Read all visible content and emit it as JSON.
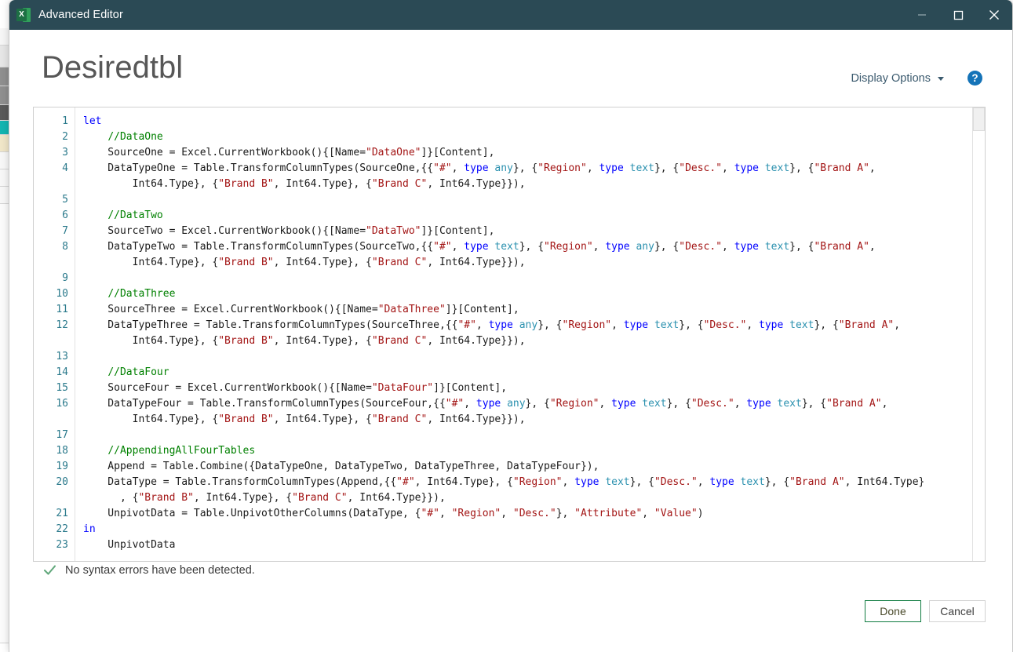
{
  "window": {
    "title": "Advanced Editor",
    "app_icon": "excel-icon",
    "icon_letter": "X",
    "minimize_label": "Minimize",
    "maximize_label": "Maximize",
    "close_label": "Close"
  },
  "header": {
    "page_title": "Desiredtbl",
    "display_options_label": "Display Options",
    "help_label": "?"
  },
  "editor": {
    "line_numbers": [
      "1",
      "2",
      "3",
      "4",
      "",
      "5",
      "6",
      "7",
      "8",
      "",
      "9",
      "10",
      "11",
      "12",
      "",
      "13",
      "14",
      "15",
      "16",
      "",
      "17",
      "18",
      "19",
      "20",
      "",
      "21",
      "22",
      "23"
    ],
    "lines": [
      {
        "n": "1",
        "tokens": [
          {
            "t": "let",
            "c": "k"
          }
        ]
      },
      {
        "n": "2",
        "tokens": [
          {
            "t": "    ",
            "c": "pl"
          },
          {
            "t": "//DataOne",
            "c": "cm"
          }
        ]
      },
      {
        "n": "3",
        "tokens": [
          {
            "t": "    SourceOne = Excel.CurrentWorkbook(){[Name=",
            "c": "pl"
          },
          {
            "t": "\"DataOne\"",
            "c": "st"
          },
          {
            "t": "]}[Content],",
            "c": "pl"
          }
        ]
      },
      {
        "n": "4",
        "tokens": [
          {
            "t": "    DataTypeOne = Table.TransformColumnTypes(SourceOne,{{",
            "c": "pl"
          },
          {
            "t": "\"#\"",
            "c": "st"
          },
          {
            "t": ", ",
            "c": "pl"
          },
          {
            "t": "type",
            "c": "k"
          },
          {
            "t": " ",
            "c": "pl"
          },
          {
            "t": "any",
            "c": "ty"
          },
          {
            "t": "}, {",
            "c": "pl"
          },
          {
            "t": "\"Region\"",
            "c": "st"
          },
          {
            "t": ", ",
            "c": "pl"
          },
          {
            "t": "type",
            "c": "k"
          },
          {
            "t": " ",
            "c": "pl"
          },
          {
            "t": "text",
            "c": "ty"
          },
          {
            "t": "}, {",
            "c": "pl"
          },
          {
            "t": "\"Desc.\"",
            "c": "st"
          },
          {
            "t": ", ",
            "c": "pl"
          },
          {
            "t": "type",
            "c": "k"
          },
          {
            "t": " ",
            "c": "pl"
          },
          {
            "t": "text",
            "c": "ty"
          },
          {
            "t": "}, {",
            "c": "pl"
          },
          {
            "t": "\"Brand A\"",
            "c": "st"
          },
          {
            "t": ",",
            "c": "pl"
          }
        ]
      },
      {
        "n": "4b",
        "tokens": [
          {
            "t": "        Int64.Type}, {",
            "c": "pl"
          },
          {
            "t": "\"Brand B\"",
            "c": "st"
          },
          {
            "t": ", Int64.Type}, {",
            "c": "pl"
          },
          {
            "t": "\"Brand C\"",
            "c": "st"
          },
          {
            "t": ", Int64.Type}}),",
            "c": "pl"
          }
        ]
      },
      {
        "n": "5",
        "tokens": []
      },
      {
        "n": "6",
        "tokens": [
          {
            "t": "    ",
            "c": "pl"
          },
          {
            "t": "//DataTwo",
            "c": "cm"
          }
        ]
      },
      {
        "n": "7",
        "tokens": [
          {
            "t": "    SourceTwo = Excel.CurrentWorkbook(){[Name=",
            "c": "pl"
          },
          {
            "t": "\"DataTwo\"",
            "c": "st"
          },
          {
            "t": "]}[Content],",
            "c": "pl"
          }
        ]
      },
      {
        "n": "8",
        "tokens": [
          {
            "t": "    DataTypeTwo = Table.TransformColumnTypes(SourceTwo,{{",
            "c": "pl"
          },
          {
            "t": "\"#\"",
            "c": "st"
          },
          {
            "t": ", ",
            "c": "pl"
          },
          {
            "t": "type",
            "c": "k"
          },
          {
            "t": " ",
            "c": "pl"
          },
          {
            "t": "text",
            "c": "ty"
          },
          {
            "t": "}, {",
            "c": "pl"
          },
          {
            "t": "\"Region\"",
            "c": "st"
          },
          {
            "t": ", ",
            "c": "pl"
          },
          {
            "t": "type",
            "c": "k"
          },
          {
            "t": " ",
            "c": "pl"
          },
          {
            "t": "any",
            "c": "ty"
          },
          {
            "t": "}, {",
            "c": "pl"
          },
          {
            "t": "\"Desc.\"",
            "c": "st"
          },
          {
            "t": ", ",
            "c": "pl"
          },
          {
            "t": "type",
            "c": "k"
          },
          {
            "t": " ",
            "c": "pl"
          },
          {
            "t": "text",
            "c": "ty"
          },
          {
            "t": "}, {",
            "c": "pl"
          },
          {
            "t": "\"Brand A\"",
            "c": "st"
          },
          {
            "t": ",",
            "c": "pl"
          }
        ]
      },
      {
        "n": "8b",
        "tokens": [
          {
            "t": "        Int64.Type}, {",
            "c": "pl"
          },
          {
            "t": "\"Brand B\"",
            "c": "st"
          },
          {
            "t": ", Int64.Type}, {",
            "c": "pl"
          },
          {
            "t": "\"Brand C\"",
            "c": "st"
          },
          {
            "t": ", Int64.Type}}),",
            "c": "pl"
          }
        ]
      },
      {
        "n": "9",
        "tokens": []
      },
      {
        "n": "10",
        "tokens": [
          {
            "t": "    ",
            "c": "pl"
          },
          {
            "t": "//DataThree",
            "c": "cm"
          }
        ]
      },
      {
        "n": "11",
        "tokens": [
          {
            "t": "    SourceThree = Excel.CurrentWorkbook(){[Name=",
            "c": "pl"
          },
          {
            "t": "\"DataThree\"",
            "c": "st"
          },
          {
            "t": "]}[Content],",
            "c": "pl"
          }
        ]
      },
      {
        "n": "12",
        "tokens": [
          {
            "t": "    DataTypeThree = Table.TransformColumnTypes(SourceThree,{{",
            "c": "pl"
          },
          {
            "t": "\"#\"",
            "c": "st"
          },
          {
            "t": ", ",
            "c": "pl"
          },
          {
            "t": "type",
            "c": "k"
          },
          {
            "t": " ",
            "c": "pl"
          },
          {
            "t": "any",
            "c": "ty"
          },
          {
            "t": "}, {",
            "c": "pl"
          },
          {
            "t": "\"Region\"",
            "c": "st"
          },
          {
            "t": ", ",
            "c": "pl"
          },
          {
            "t": "type",
            "c": "k"
          },
          {
            "t": " ",
            "c": "pl"
          },
          {
            "t": "text",
            "c": "ty"
          },
          {
            "t": "}, {",
            "c": "pl"
          },
          {
            "t": "\"Desc.\"",
            "c": "st"
          },
          {
            "t": ", ",
            "c": "pl"
          },
          {
            "t": "type",
            "c": "k"
          },
          {
            "t": " ",
            "c": "pl"
          },
          {
            "t": "text",
            "c": "ty"
          },
          {
            "t": "}, {",
            "c": "pl"
          },
          {
            "t": "\"Brand A\"",
            "c": "st"
          },
          {
            "t": ",",
            "c": "pl"
          }
        ]
      },
      {
        "n": "12b",
        "tokens": [
          {
            "t": "        Int64.Type}, {",
            "c": "pl"
          },
          {
            "t": "\"Brand B\"",
            "c": "st"
          },
          {
            "t": ", Int64.Type}, {",
            "c": "pl"
          },
          {
            "t": "\"Brand C\"",
            "c": "st"
          },
          {
            "t": ", Int64.Type}}),",
            "c": "pl"
          }
        ]
      },
      {
        "n": "13",
        "tokens": []
      },
      {
        "n": "14",
        "tokens": [
          {
            "t": "    ",
            "c": "pl"
          },
          {
            "t": "//DataFour",
            "c": "cm"
          }
        ]
      },
      {
        "n": "15",
        "tokens": [
          {
            "t": "    SourceFour = Excel.CurrentWorkbook(){[Name=",
            "c": "pl"
          },
          {
            "t": "\"DataFour\"",
            "c": "st"
          },
          {
            "t": "]}[Content],",
            "c": "pl"
          }
        ]
      },
      {
        "n": "16",
        "tokens": [
          {
            "t": "    DataTypeFour = Table.TransformColumnTypes(SourceFour,{{",
            "c": "pl"
          },
          {
            "t": "\"#\"",
            "c": "st"
          },
          {
            "t": ", ",
            "c": "pl"
          },
          {
            "t": "type",
            "c": "k"
          },
          {
            "t": " ",
            "c": "pl"
          },
          {
            "t": "any",
            "c": "ty"
          },
          {
            "t": "}, {",
            "c": "pl"
          },
          {
            "t": "\"Region\"",
            "c": "st"
          },
          {
            "t": ", ",
            "c": "pl"
          },
          {
            "t": "type",
            "c": "k"
          },
          {
            "t": " ",
            "c": "pl"
          },
          {
            "t": "text",
            "c": "ty"
          },
          {
            "t": "}, {",
            "c": "pl"
          },
          {
            "t": "\"Desc.\"",
            "c": "st"
          },
          {
            "t": ", ",
            "c": "pl"
          },
          {
            "t": "type",
            "c": "k"
          },
          {
            "t": " ",
            "c": "pl"
          },
          {
            "t": "text",
            "c": "ty"
          },
          {
            "t": "}, {",
            "c": "pl"
          },
          {
            "t": "\"Brand A\"",
            "c": "st"
          },
          {
            "t": ",",
            "c": "pl"
          }
        ]
      },
      {
        "n": "16b",
        "tokens": [
          {
            "t": "        Int64.Type}, {",
            "c": "pl"
          },
          {
            "t": "\"Brand B\"",
            "c": "st"
          },
          {
            "t": ", Int64.Type}, {",
            "c": "pl"
          },
          {
            "t": "\"Brand C\"",
            "c": "st"
          },
          {
            "t": ", Int64.Type}}),",
            "c": "pl"
          }
        ]
      },
      {
        "n": "17",
        "tokens": []
      },
      {
        "n": "18",
        "tokens": [
          {
            "t": "    ",
            "c": "pl"
          },
          {
            "t": "//AppendingAllFourTables",
            "c": "cm"
          }
        ]
      },
      {
        "n": "19",
        "tokens": [
          {
            "t": "    Append = Table.Combine({DataTypeOne, DataTypeTwo, DataTypeThree, DataTypeFour}),",
            "c": "pl"
          }
        ]
      },
      {
        "n": "20",
        "tokens": [
          {
            "t": "    DataType = Table.TransformColumnTypes(Append,{{",
            "c": "pl"
          },
          {
            "t": "\"#\"",
            "c": "st"
          },
          {
            "t": ", Int64.Type}, {",
            "c": "pl"
          },
          {
            "t": "\"Region\"",
            "c": "st"
          },
          {
            "t": ", ",
            "c": "pl"
          },
          {
            "t": "type",
            "c": "k"
          },
          {
            "t": " ",
            "c": "pl"
          },
          {
            "t": "text",
            "c": "ty"
          },
          {
            "t": "}, {",
            "c": "pl"
          },
          {
            "t": "\"Desc.\"",
            "c": "st"
          },
          {
            "t": ", ",
            "c": "pl"
          },
          {
            "t": "type",
            "c": "k"
          },
          {
            "t": " ",
            "c": "pl"
          },
          {
            "t": "text",
            "c": "ty"
          },
          {
            "t": "}, {",
            "c": "pl"
          },
          {
            "t": "\"Brand A\"",
            "c": "st"
          },
          {
            "t": ", Int64.Type}",
            "c": "pl"
          }
        ]
      },
      {
        "n": "20b",
        "tokens": [
          {
            "t": "      , {",
            "c": "pl"
          },
          {
            "t": "\"Brand B\"",
            "c": "st"
          },
          {
            "t": ", Int64.Type}, {",
            "c": "pl"
          },
          {
            "t": "\"Brand C\"",
            "c": "st"
          },
          {
            "t": ", Int64.Type}}),",
            "c": "pl"
          }
        ]
      },
      {
        "n": "21",
        "tokens": [
          {
            "t": "    UnpivotData = Table.UnpivotOtherColumns(DataType, {",
            "c": "pl"
          },
          {
            "t": "\"#\"",
            "c": "st"
          },
          {
            "t": ", ",
            "c": "pl"
          },
          {
            "t": "\"Region\"",
            "c": "st"
          },
          {
            "t": ", ",
            "c": "pl"
          },
          {
            "t": "\"Desc.\"",
            "c": "st"
          },
          {
            "t": "}, ",
            "c": "pl"
          },
          {
            "t": "\"Attribute\"",
            "c": "st"
          },
          {
            "t": ", ",
            "c": "pl"
          },
          {
            "t": "\"Value\"",
            "c": "st"
          },
          {
            "t": ")",
            "c": "pl"
          }
        ]
      },
      {
        "n": "22",
        "tokens": [
          {
            "t": "in",
            "c": "k"
          }
        ]
      },
      {
        "n": "23",
        "tokens": [
          {
            "t": "    UnpivotData",
            "c": "pl"
          }
        ]
      }
    ]
  },
  "status": {
    "message": "No syntax errors have been detected.",
    "icon": "checkmark-icon",
    "icon_color": "#62a87c"
  },
  "footer": {
    "done_label": "Done",
    "cancel_label": "Cancel"
  },
  "colors": {
    "titlebar": "#2b4a55",
    "keyword": "#0000ff",
    "comment": "#008000",
    "string": "#a31515",
    "type": "#2b91af",
    "line_number": "#2b7a8c",
    "accent_green": "#107c41",
    "help_blue": "#1473b8"
  }
}
